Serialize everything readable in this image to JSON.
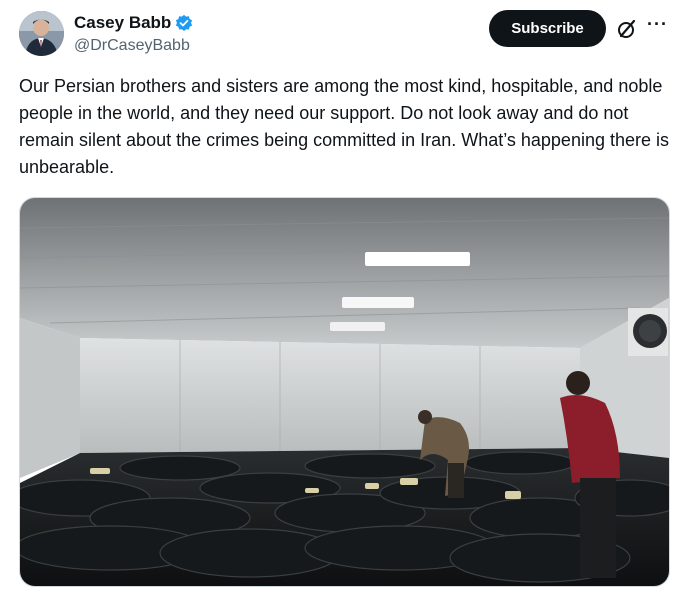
{
  "author": {
    "display_name": "Casey Babb",
    "handle": "@DrCaseyBabb",
    "verified": true,
    "verified_color": "#1d9bf0"
  },
  "actions": {
    "subscribe_label": "Subscribe",
    "grok_icon": "grok-slash-circle-icon",
    "more_icon": "more-horizontal-icon",
    "more_label": "···"
  },
  "tweet": {
    "text": "Our Persian brothers and sisters are among the most kind, hospitable, and noble people in the world, and they need our support. Do not look away and do not remain silent about the crimes being committed in Iran. What’s happening there is unbearable."
  },
  "media": {
    "kind": "photo"
  }
}
